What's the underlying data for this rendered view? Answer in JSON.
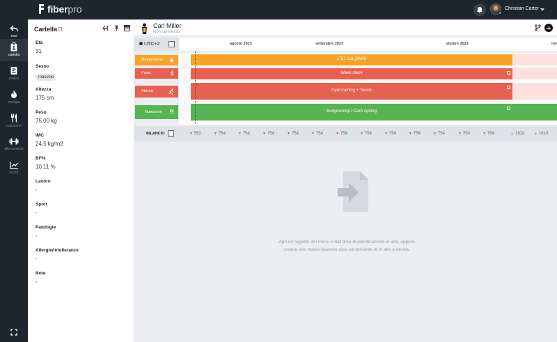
{
  "app": {
    "brand_bold": "fiber",
    "brand_light": "pro"
  },
  "header": {
    "user_name": "Christian Carter"
  },
  "rail": {
    "items": [
      {
        "label": "esci",
        "icon": "back-arrow-icon"
      },
      {
        "label": "cartella",
        "icon": "clipboard-icon"
      },
      {
        "label": "analisi",
        "icon": "chart-doc-icon"
      },
      {
        "label": "energia",
        "icon": "flame-icon"
      },
      {
        "label": "nutrizione",
        "icon": "fork-knife-icon"
      },
      {
        "label": "allenamento",
        "icon": "dumbbell-icon"
      },
      {
        "label": "report",
        "icon": "trend-chart-icon"
      }
    ]
  },
  "panel": {
    "title": "Cartella",
    "fields": [
      {
        "label": "Età",
        "value": "31"
      },
      {
        "label": "Sesso",
        "value": "maschio"
      },
      {
        "label": "Altezza",
        "value": "175 cm"
      },
      {
        "label": "Peso",
        "value": "75.00 kg"
      },
      {
        "label": "IMC",
        "value": "24.5 kg/m2"
      },
      {
        "label": "BF%",
        "value": "10.11 %"
      },
      {
        "label": "Lavoro",
        "value": "-"
      },
      {
        "label": "Sport",
        "value": "-"
      },
      {
        "label": "Patologie",
        "value": "-"
      },
      {
        "label": "Allergie/intolleranze",
        "value": "-"
      },
      {
        "label": "Note",
        "value": "-"
      }
    ]
  },
  "client": {
    "name": "Carl Miller",
    "status": "Non connesso"
  },
  "timeline": {
    "timezone": "UTC+2",
    "months": [
      "agosto 2023",
      "settembre 2023",
      "ottobre 2023",
      "nov"
    ],
    "rows": [
      {
        "label": "Metabolismo",
        "color": "#f9a227",
        "bar": "1757 Cal (BMR)"
      },
      {
        "label": "Passi",
        "color": "#e8604f",
        "bar": "Week steps"
      },
      {
        "label": "Attività",
        "color": "#e8604f",
        "bar": "Gym training + Tennis"
      },
      {
        "label": "Nutrizione",
        "color": "#57b453",
        "bar": "Bodyrecomp / Carb cycling"
      }
    ],
    "balance_label": "BILANCIO",
    "balance_values": [
      {
        "dir": "down",
        "v": "552"
      },
      {
        "dir": "down",
        "v": "754"
      },
      {
        "dir": "down",
        "v": "754"
      },
      {
        "dir": "down",
        "v": "754"
      },
      {
        "dir": "down",
        "v": "754"
      },
      {
        "dir": "down",
        "v": "754"
      },
      {
        "dir": "down",
        "v": "754"
      },
      {
        "dir": "down",
        "v": "754"
      },
      {
        "dir": "down",
        "v": "754"
      },
      {
        "dir": "down",
        "v": "754"
      },
      {
        "dir": "down",
        "v": "754"
      },
      {
        "dir": "down",
        "v": "754"
      },
      {
        "dir": "down",
        "v": "754"
      },
      {
        "dir": "up",
        "v": "1102"
      },
      {
        "dir": "up",
        "v": "1613"
      }
    ]
  },
  "empty_state": {
    "line1": "Apri un oggetto dal menu o dall'area di pianificazione in alto, oppure",
    "line2_pre": "creane uno nuovo facendo click sul pulsante",
    "line2_post": "in alto a destra."
  }
}
